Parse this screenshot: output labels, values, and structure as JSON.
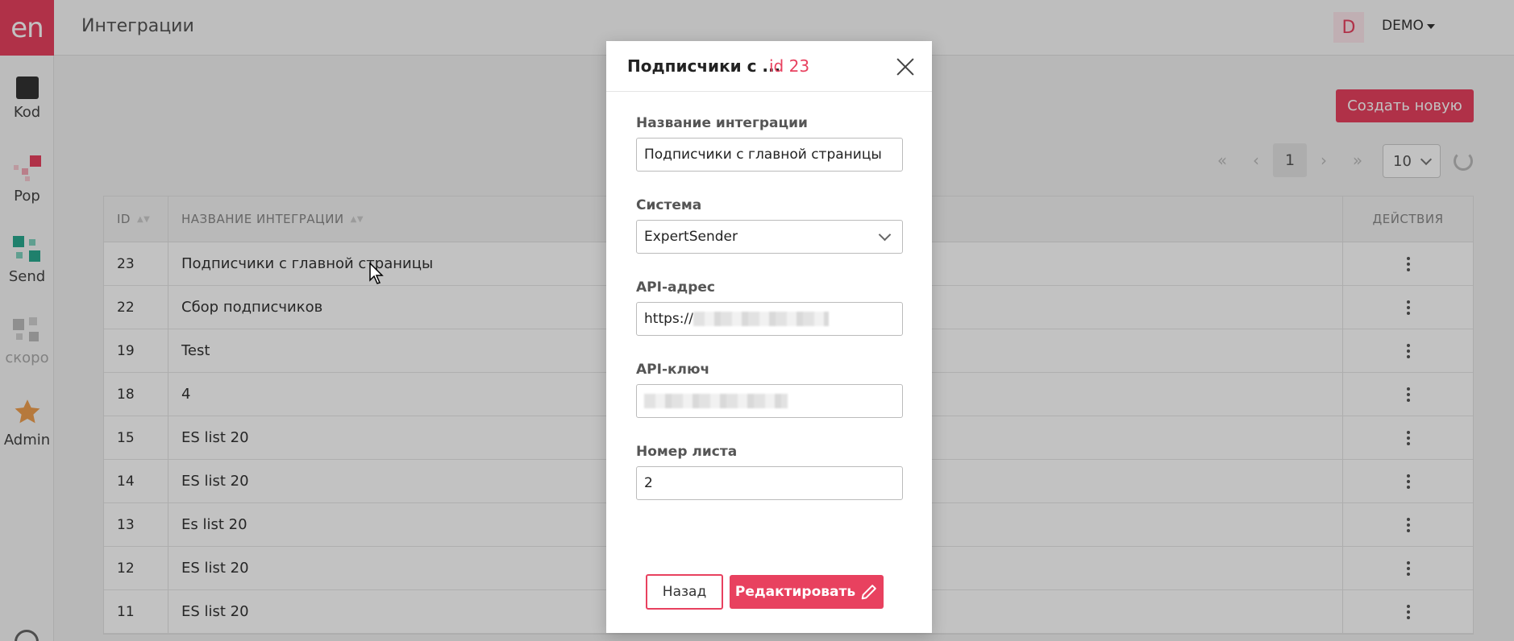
{
  "brand": {
    "logo_text": "en",
    "accent": "#e8415f"
  },
  "sidebar": {
    "items": [
      {
        "label": "Kod",
        "icon": "square-icon"
      },
      {
        "label": "Pop",
        "icon": "pop-icon"
      },
      {
        "label": "Send",
        "icon": "send-grid-icon"
      },
      {
        "label": "скоро",
        "icon": "grid-icon"
      },
      {
        "label": "Admin",
        "icon": "star-icon"
      }
    ]
  },
  "header": {
    "title": "Интеграции",
    "avatar_letter": "D",
    "user_name": "DEMO"
  },
  "toolbar": {
    "create_label": "Создать новую",
    "pagination": {
      "current": "1",
      "per_page": "10"
    }
  },
  "table": {
    "headers": {
      "id": "ID",
      "name": "НАЗВАНИЕ ИНТЕГРАЦИИ",
      "actions": "ДЕЙСТВИЯ"
    },
    "rows": [
      {
        "id": "23",
        "name": "Подписчики с главной страницы"
      },
      {
        "id": "22",
        "name": "Сбор подписчиков"
      },
      {
        "id": "19",
        "name": "Test"
      },
      {
        "id": "18",
        "name": "4"
      },
      {
        "id": "15",
        "name": "ES list 20"
      },
      {
        "id": "14",
        "name": "ES list 20"
      },
      {
        "id": "13",
        "name": "Es list 20"
      },
      {
        "id": "12",
        "name": "ES list 20"
      },
      {
        "id": "11",
        "name": "ES list 20"
      }
    ]
  },
  "modal": {
    "title": "Подписчики с ...",
    "id_label": "id 23",
    "fields": {
      "name_label": "Название интеграции",
      "name_value": "Подписчики с главной страницы",
      "system_label": "Система",
      "system_value": "ExpertSender",
      "api_url_label": "API-адрес",
      "api_url_value": "https://",
      "api_key_label": "API-ключ",
      "list_label": "Номер листа",
      "list_value": "2"
    },
    "back_label": "Назад",
    "edit_label": "Редактировать"
  }
}
